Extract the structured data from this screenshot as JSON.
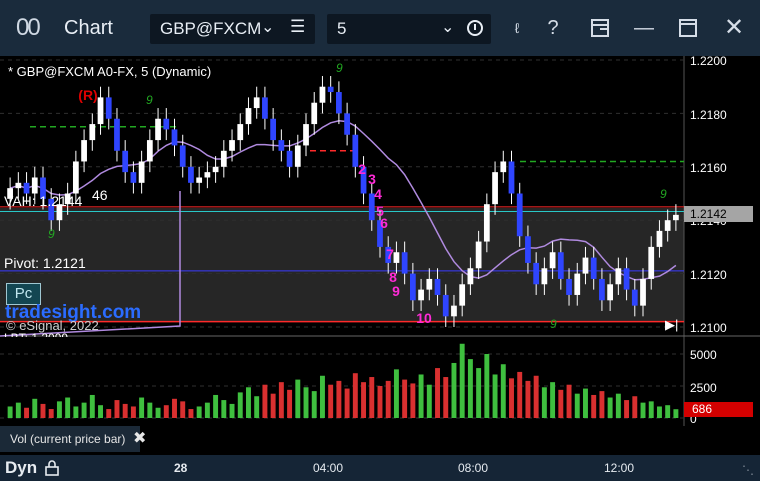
{
  "titlebar": {
    "icon": "00",
    "title": "Chart",
    "symbol": "GBP@FXCM",
    "interval": "5",
    "brand_color": "#1a2b3c"
  },
  "chart": {
    "header": "* GBP@FXCM A0-FX, 5 (Dynamic)",
    "vah": "VAH: 1.2144",
    "vah_overlay": "46",
    "pivot": "Pivot: 1.2121",
    "pc_button": "Pc",
    "watermark": "tradesight.com",
    "copyright": "© eSignal, 2022",
    "lbt_fragment": "LBT: 1.2099",
    "current_price": "1.2142",
    "current_volume": "686",
    "price_axis": [
      "1.2200",
      "1.2180",
      "1.2160",
      "1.2140",
      "1.2120",
      "1.2100"
    ],
    "volume_axis": [
      "5000",
      "2500",
      "0"
    ],
    "time_axis": [
      "28",
      "04:00",
      "08:00",
      "12:00"
    ],
    "volume_panel_label": "Vol (current price bar)",
    "bottom_label": "Dyn",
    "markers": {
      "r": "(R)",
      "counts": [
        "2",
        "3",
        "4",
        "5",
        "6",
        "7",
        "8",
        "9",
        "10"
      ],
      "nine": "9"
    },
    "colors": {
      "bull_bar": "#ffffff",
      "bear_bar": "#2f45ff",
      "wick": "#ffffff",
      "ma": "#b08adf",
      "resistance": "#ff2a2a",
      "support_line": "#3b3bff",
      "cyan_line": "#29c7c7",
      "green_dash": "#22a822",
      "magenta": "#ff2bd6",
      "vol_up": "#3fbf3f",
      "vol_down": "#d93030"
    }
  },
  "chart_data": {
    "type": "candlestick",
    "title": "* GBP@FXCM A0-FX, 5 (Dynamic)",
    "ylim": [
      1.2098,
      1.2202
    ],
    "y_ticks": [
      1.21,
      1.212,
      1.214,
      1.216,
      1.218,
      1.22
    ],
    "x_ticks": [
      "28",
      "04:00",
      "08:00",
      "12:00"
    ],
    "levels": {
      "VAH": 1.2144,
      "Pivot": 1.2121,
      "Current": 1.2142
    },
    "close": [
      1.2152,
      1.2154,
      1.215,
      1.2156,
      1.2148,
      1.214,
      1.2146,
      1.215,
      1.2162,
      1.217,
      1.2176,
      1.2186,
      1.2178,
      1.2166,
      1.2158,
      1.2154,
      1.2162,
      1.217,
      1.2178,
      1.2174,
      1.2168,
      1.216,
      1.2154,
      1.2156,
      1.2158,
      1.216,
      1.2166,
      1.217,
      1.2176,
      1.2182,
      1.2186,
      1.2178,
      1.217,
      1.2166,
      1.216,
      1.2168,
      1.2176,
      1.2184,
      1.219,
      1.2188,
      1.218,
      1.2172,
      1.216,
      1.215,
      1.214,
      1.213,
      1.2124,
      1.2128,
      1.212,
      1.211,
      1.2114,
      1.2118,
      1.2112,
      1.2104,
      1.2108,
      1.2116,
      1.2122,
      1.2132,
      1.2146,
      1.2158,
      1.2162,
      1.215,
      1.2134,
      1.2124,
      1.2116,
      1.2122,
      1.2128,
      1.2118,
      1.2112,
      1.212,
      1.2126,
      1.2118,
      1.211,
      1.2116,
      1.2122,
      1.2114,
      1.2108,
      1.2118,
      1.213,
      1.2136,
      1.214,
      1.2142
    ],
    "volume": [
      900,
      1200,
      800,
      1500,
      1100,
      700,
      1300,
      1600,
      900,
      1200,
      1800,
      1000,
      700,
      1400,
      1100,
      900,
      1600,
      1200,
      800,
      1000,
      1500,
      1300,
      700,
      900,
      1200,
      1800,
      1400,
      1100,
      2000,
      2400,
      1700,
      2600,
      1900,
      2800,
      2200,
      3000,
      2400,
      2100,
      3300,
      2600,
      2900,
      2300,
      3500,
      2800,
      3200,
      2500,
      2900,
      3800,
      3000,
      2700,
      3400,
      2600,
      3900,
      3200,
      4300,
      5800,
      4600,
      3900,
      5000,
      3400,
      4200,
      3100,
      3600,
      2900,
      3300,
      2400,
      2800,
      2200,
      2600,
      1900,
      2300,
      1800,
      2100,
      1600,
      1900,
      1400,
      1700,
      1200,
      1300,
      900,
      1000,
      686
    ]
  }
}
